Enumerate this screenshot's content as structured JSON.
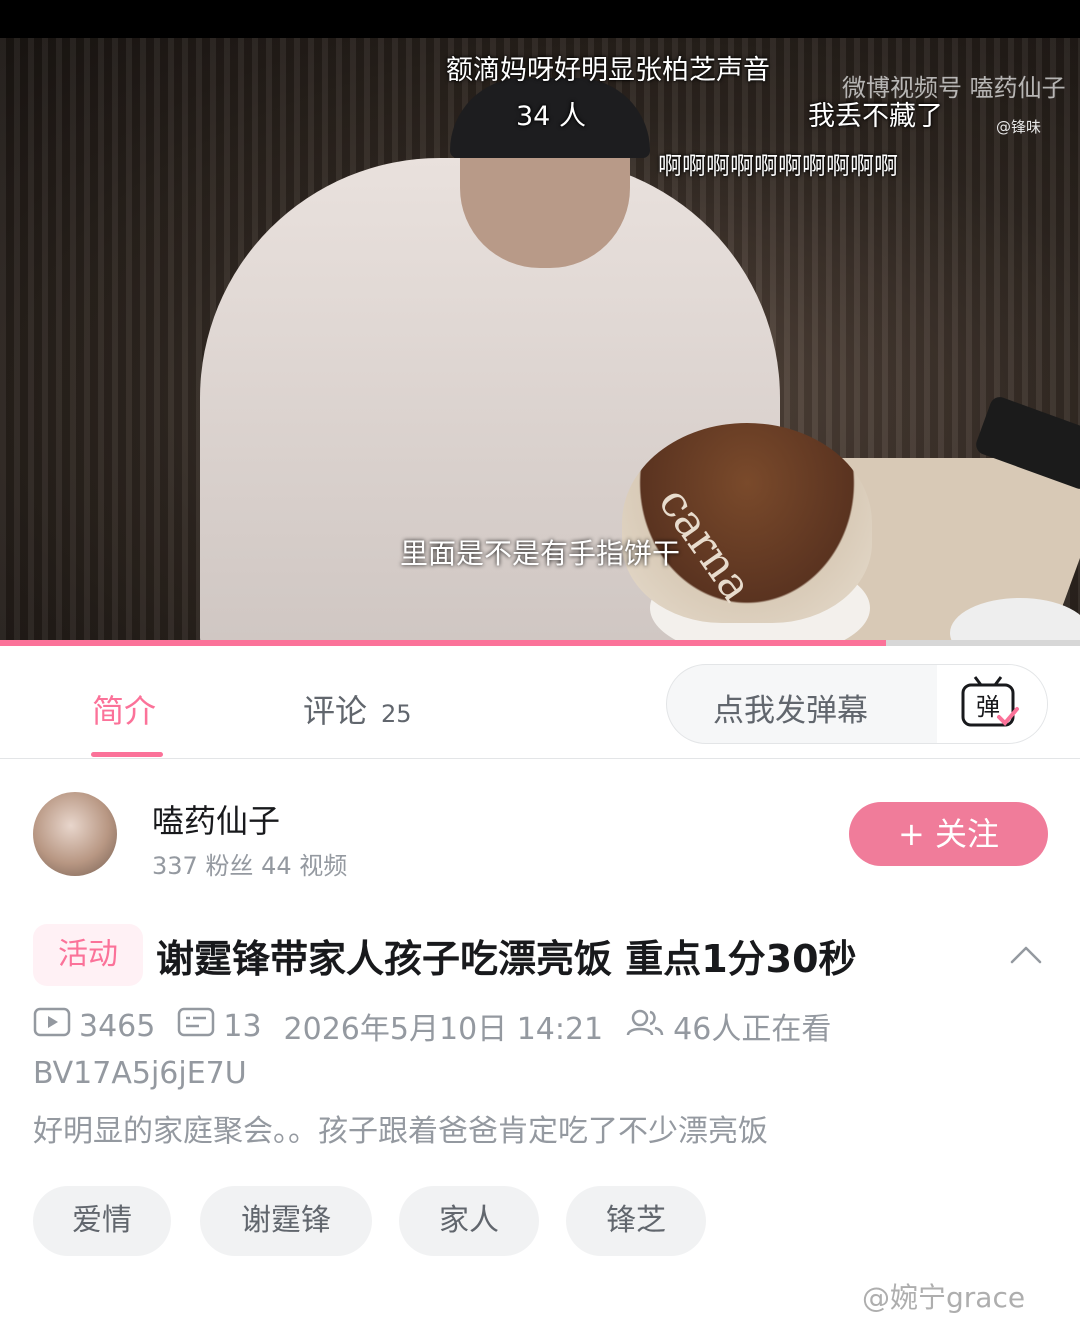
{
  "video": {
    "danmaku": [
      "额滴妈呀好明显张柏芝声音",
      "34 人",
      "我丢不藏了",
      "啊啊啊啊啊啊啊啊啊啊"
    ],
    "watermark": "微博视频号 嗑药仙子",
    "watermark_handle": "@锋味",
    "subtitle": "里面是不是有手指饼干",
    "cake_text": "carna",
    "progress": 0.82
  },
  "tabs": {
    "intro_label": "简介",
    "comments_label": "评论",
    "comments_count": "25",
    "danmaku_placeholder": "点我发弹幕",
    "danmaku_icon_text": "弹"
  },
  "uploader": {
    "name": "嗑药仙子",
    "stats": "337 粉丝  44 视频",
    "follow_label": "+ 关注"
  },
  "post": {
    "tag": "活动",
    "title": "谢霆锋带家人孩子吃漂亮饭 重点1分30秒",
    "views": "3465",
    "danmaku_count": "13",
    "datetime": "2026年5月10日 14:21",
    "watching": "46人正在看",
    "bvid": "BV17A5j6jE7U",
    "description": "好明显的家庭聚会。。孩子跟着爸爸肯定吃了不少漂亮饭",
    "tags": [
      "爱情",
      "谢霆锋",
      "家人",
      "锋芝"
    ]
  },
  "footer_watermark": "@婉宁grace",
  "colors": {
    "accent": "#fb7299",
    "follow": "#f07c9a",
    "muted": "#9499a0"
  }
}
